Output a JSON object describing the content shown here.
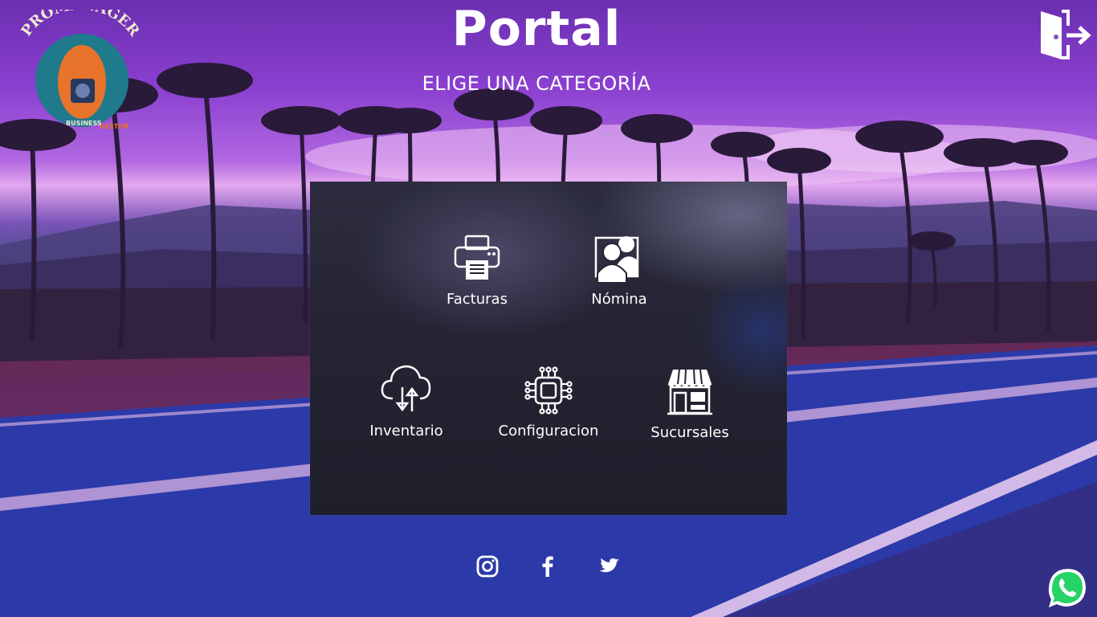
{
  "header": {
    "title": "Portal",
    "subtitle": "ELIGE UNA CATEGORÍA",
    "logo": {
      "brand_text": "PROMANAGER",
      "tagline_a": "BUSINESS",
      "tagline_b": "GESTOR"
    },
    "logout_icon": "door-exit-icon"
  },
  "categories": [
    {
      "label": "Facturas",
      "icon": "printer-icon"
    },
    {
      "label": "Nómina",
      "icon": "users-icon"
    },
    {
      "label": "Inventario",
      "icon": "cloud-sync-icon"
    },
    {
      "label": "Configuracion",
      "icon": "chip-icon"
    },
    {
      "label": "Sucursales",
      "icon": "store-icon"
    }
  ],
  "footer": {
    "social": [
      {
        "name": "Instagram",
        "icon": "instagram-icon"
      },
      {
        "name": "Facebook",
        "icon": "facebook-icon"
      },
      {
        "name": "Twitter",
        "icon": "twitter-icon"
      }
    ],
    "whatsapp": {
      "icon": "whatsapp-icon"
    }
  },
  "colors": {
    "sky": "#8a3fcf",
    "road": "#2a3fae",
    "panel": "#242434",
    "text": "#ffffff",
    "logo_teal": "#1f7a8c",
    "logo_orange": "#e8732a",
    "whatsapp_green": "#25d366"
  }
}
